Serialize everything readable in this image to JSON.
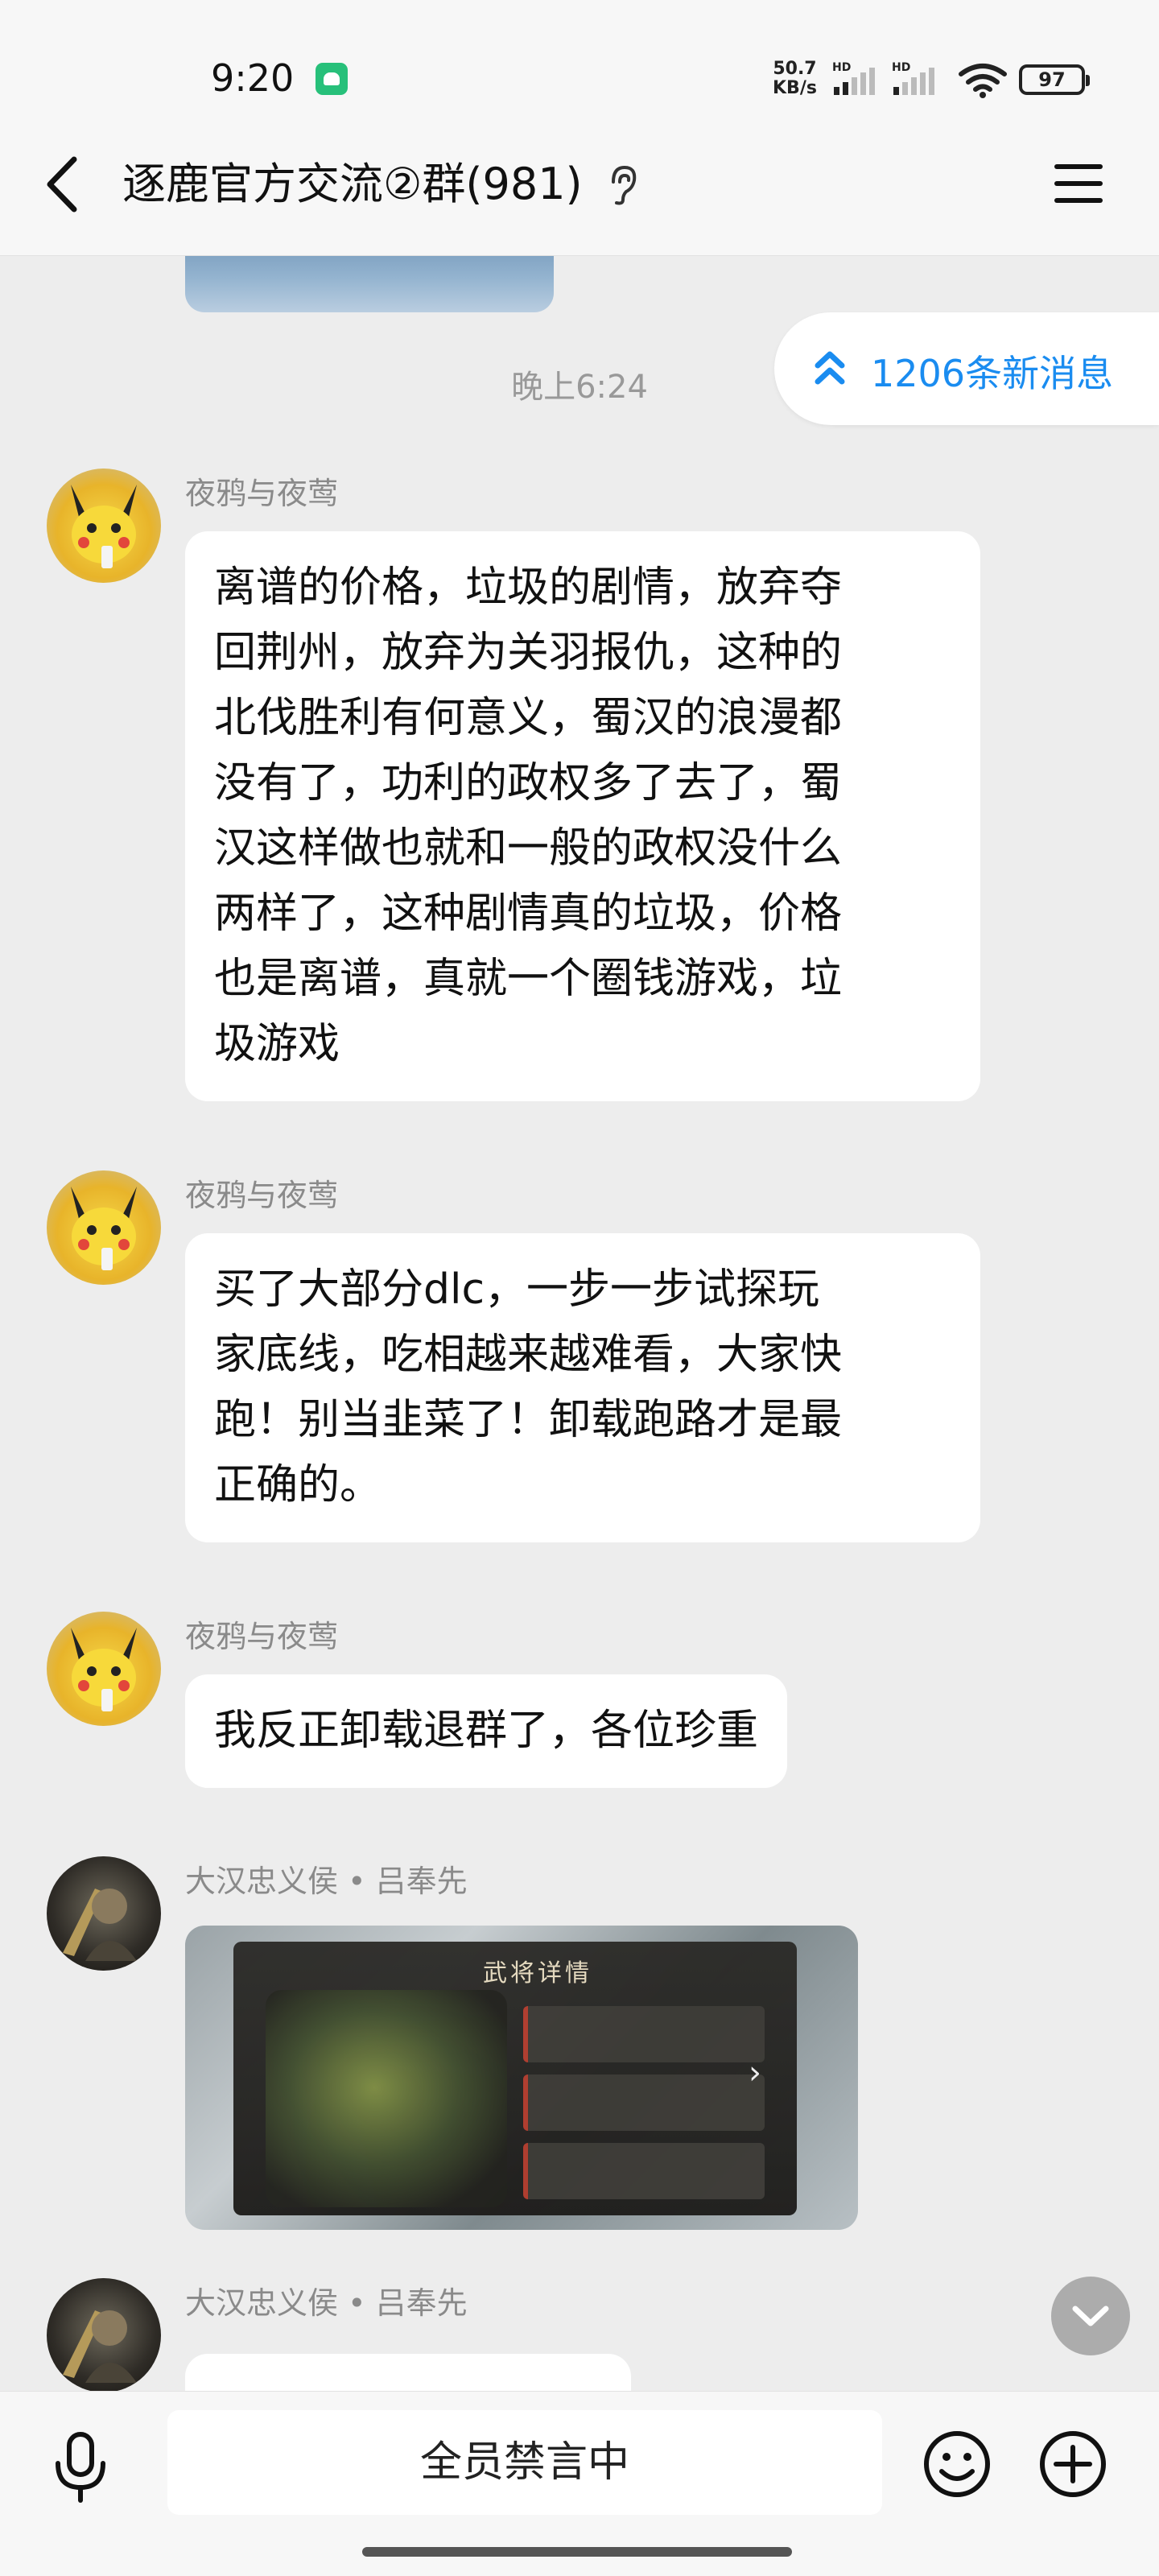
{
  "status_bar": {
    "time": "9:20",
    "net_speed_value": "50.7",
    "net_speed_unit": "KB/s",
    "signal_label_1": "HD",
    "signal_label_2": "HD",
    "battery": "97"
  },
  "header": {
    "title": "逐鹿官方交流②群(981)"
  },
  "chat": {
    "new_messages": "1206条新消息",
    "timestamp": "晚上6:24",
    "messages": [
      {
        "sender": "夜鸦与夜莺",
        "lines": [
          "离谱的价格，垃圾的剧情，放弃夺",
          "回荆州，放弃为关羽报仇，这种的",
          "北伐胜利有何意义，蜀汉的浪漫都",
          "没有了，功利的政权多了去了，蜀",
          "汉这样做也就和一般的政权没什么",
          "两样了，这种剧情真的垃圾，价格",
          "也是离谱，真就一个圈钱游戏，垃",
          "圾游戏"
        ]
      },
      {
        "sender": "夜鸦与夜莺",
        "lines": [
          "买了大部分dlc，一步一步试探玩",
          "家底线，吃相越来越难看，大家快",
          "跑！别当韭菜了！卸载跑路才是最",
          "正确的。"
        ]
      },
      {
        "sender": "夜鸦与夜莺",
        "lines": [
          "我反正卸载退群了，各位珍重"
        ]
      },
      {
        "sender": "大汉忠义侯 • 吕奉先",
        "image_caption": "武将详情"
      },
      {
        "sender": "大汉忠义侯 • 吕奉先"
      }
    ]
  },
  "input_bar": {
    "muted_text": "全员禁言中"
  },
  "colors": {
    "accent": "#1a8cf0",
    "background": "#ededed",
    "bubble": "#ffffff"
  }
}
